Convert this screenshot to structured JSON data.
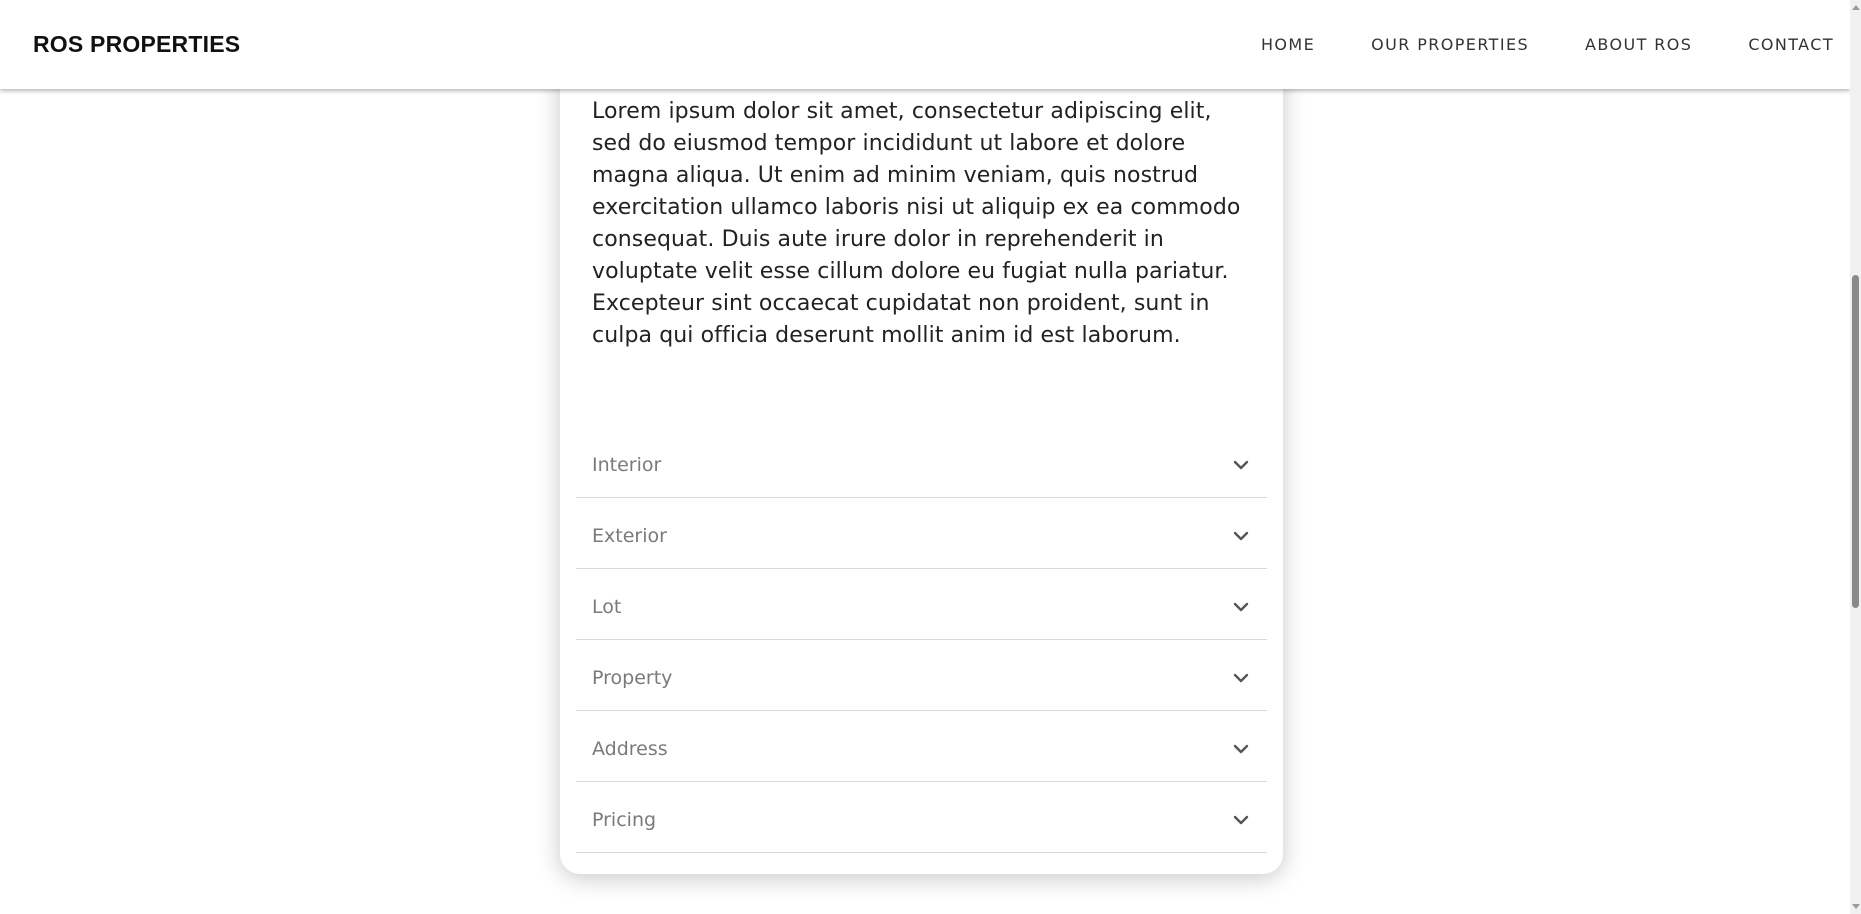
{
  "header": {
    "logo": "ROS PROPERTIES",
    "nav": [
      {
        "label": "HOME"
      },
      {
        "label": "OUR PROPERTIES"
      },
      {
        "label": "ABOUT ROS"
      },
      {
        "label": "CONTACT"
      }
    ]
  },
  "card": {
    "description": "Lorem ipsum dolor sit amet, consectetur adipiscing elit, sed do eiusmod tempor incididunt ut labore et dolore magna aliqua. Ut enim ad minim veniam, quis nostrud exercitation ullamco laboris nisi ut aliquip ex ea commodo consequat. Duis aute irure dolor in reprehenderit in voluptate velit esse cillum dolore eu fugiat nulla pariatur. Excepteur sint occaecat cupidatat non proident, sunt in culpa qui officia deserunt mollit anim id est laborum.",
    "accordion": [
      {
        "label": "Interior",
        "icon": "chevron-down-icon"
      },
      {
        "label": "Exterior",
        "icon": "chevron-down-icon"
      },
      {
        "label": "Lot",
        "icon": "chevron-down-icon"
      },
      {
        "label": "Property",
        "icon": "chevron-down-icon"
      },
      {
        "label": "Address",
        "icon": "chevron-down-icon"
      },
      {
        "label": "Pricing",
        "icon": "chevron-down-icon"
      }
    ]
  },
  "colors": {
    "text": "#222222",
    "accordion_label": "#7a7a7a",
    "divider": "#d9d9d9"
  }
}
